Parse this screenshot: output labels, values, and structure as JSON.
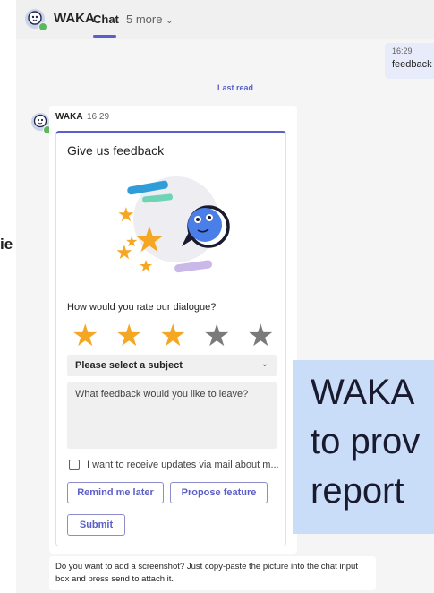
{
  "left_fragment": "ie",
  "header": {
    "title": "WAKA",
    "tabs": [
      {
        "label": "Chat"
      },
      {
        "label": "5 more"
      }
    ],
    "more_chevron": "⌄"
  },
  "sent_message": {
    "time": "16:29",
    "text": "feedback"
  },
  "divider": {
    "label": "Last read"
  },
  "bot_message": {
    "sender": "WAKA",
    "time": "16:29",
    "card": {
      "title": "Give us feedback",
      "rating_question": "How would you rate our dialogue?",
      "rating": 3,
      "rating_max": 5,
      "star_glyph": "★",
      "subject_select": {
        "value": "Please select a subject",
        "chevron": "⌄"
      },
      "feedback_placeholder": "What feedback would you like to leave?",
      "checkbox_label": "I want to receive updates via mail about m...",
      "checkbox_checked": false,
      "buttons": {
        "remind": "Remind me later",
        "propose": "Propose feature",
        "submit": "Submit"
      }
    }
  },
  "note": {
    "text": "Do you want to add a screenshot? Just copy-paste the picture into the chat input box and press send to attach it."
  },
  "overlay": {
    "text": "WAKA\nto prov\nreport"
  },
  "colors": {
    "accent": "#5b5fc7",
    "star_on": "#f5a623",
    "star_off": "#7a7a7a",
    "presence": "#5cb85c",
    "overlay_bg": "#c9dcf8"
  }
}
